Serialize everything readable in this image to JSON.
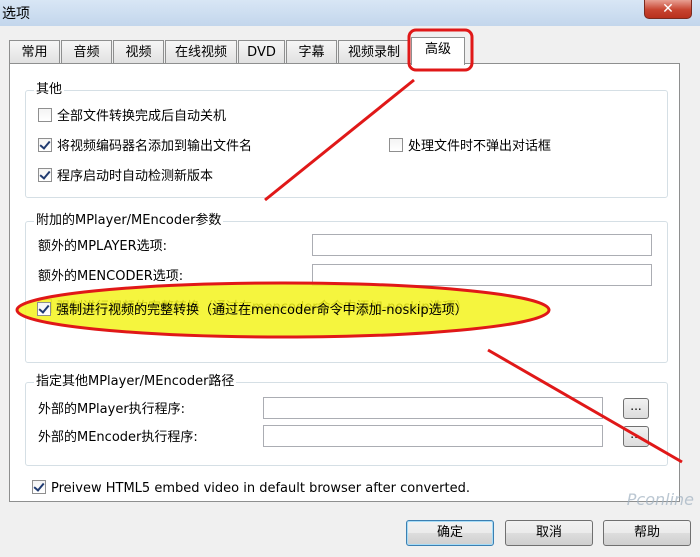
{
  "window": {
    "title": "选项",
    "close_glyph": "✕"
  },
  "tabs": [
    {
      "label": "常用"
    },
    {
      "label": "音频"
    },
    {
      "label": "视频"
    },
    {
      "label": "在线视频"
    },
    {
      "label": "DVD"
    },
    {
      "label": "字幕"
    },
    {
      "label": "视频录制"
    },
    {
      "label": "高级",
      "active": true
    }
  ],
  "group_other": {
    "title": "其他",
    "shutdown": {
      "label": "全部文件转换完成后自动关机",
      "checked": false
    },
    "add_codec_name": {
      "label": "将视频编码器名添加到输出文件名",
      "checked": true
    },
    "auto_update": {
      "label": "程序启动时自动检测新版本",
      "checked": true
    },
    "no_dialog": {
      "label": "处理文件时不弹出对话框",
      "checked": false
    }
  },
  "group_params": {
    "title": "附加的MPlayer/MEncoder参数",
    "mplayer_opts": {
      "label": "额外的MPLAYER选项:",
      "value": ""
    },
    "mencoder_opts": {
      "label": "额外的MENCODER选项:",
      "value": ""
    },
    "force_full": {
      "label": "强制进行视频的完整转换（通过在mencoder命令中添加-noskip选项）",
      "checked": true
    }
  },
  "group_paths": {
    "title": "指定其他MPlayer/MEncoder路径",
    "mplayer_exe": {
      "label": "外部的MPlayer执行程序:",
      "value": "",
      "browse": "..."
    },
    "mencoder_exe": {
      "label": "外部的MEncoder执行程序:",
      "value": "",
      "browse": "..."
    }
  },
  "preview_html5": {
    "label": "Preivew HTML5 embed video in default browser after converted.",
    "checked": true
  },
  "buttons": {
    "ok": "确定",
    "cancel": "取消",
    "help": "帮助"
  },
  "annotation_colors": {
    "highlight": "#f3f31c",
    "stroke": "#e01818"
  },
  "watermark": "Pconline"
}
